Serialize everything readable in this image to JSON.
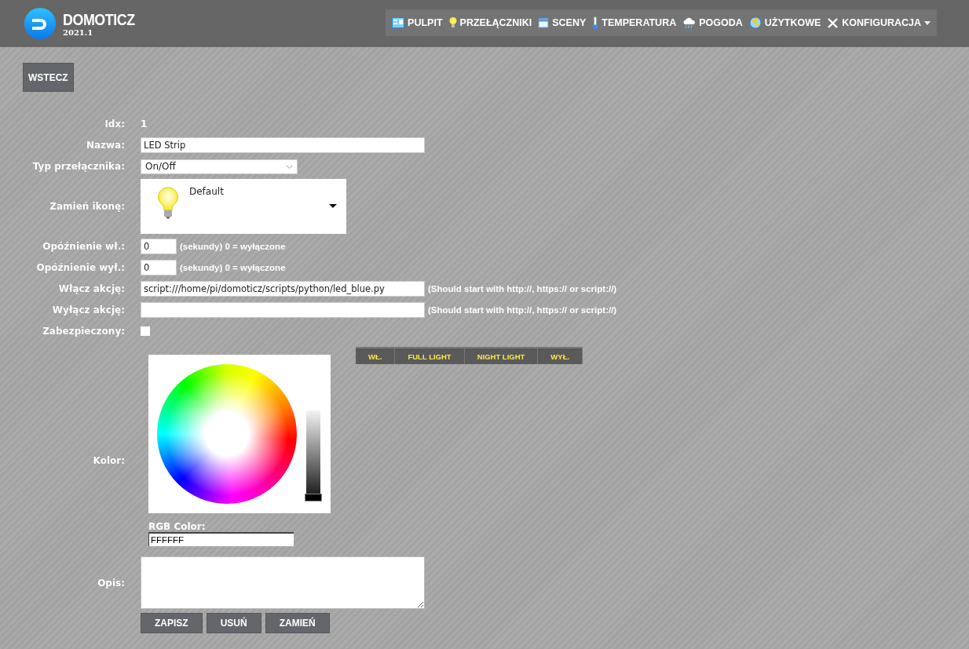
{
  "header": {
    "title": "DOMOTICZ",
    "version": "2021.1"
  },
  "nav": [
    {
      "label": "PULPIT",
      "dropdown": false
    },
    {
      "label": "PRZEŁĄCZNIKI",
      "dropdown": false
    },
    {
      "label": "SCENY",
      "dropdown": false
    },
    {
      "label": "TEMPERATURA",
      "dropdown": false
    },
    {
      "label": "POGODA",
      "dropdown": false
    },
    {
      "label": "UŻYTKOWE",
      "dropdown": false
    },
    {
      "label": "KONFIGURACJA",
      "dropdown": true
    }
  ],
  "back_button": "WSTECZ",
  "fields": [
    {
      "kind": "text",
      "label": "Idx:",
      "value": "1"
    },
    {
      "kind": "input",
      "label": "Nazwa:",
      "value": "LED Strip"
    },
    {
      "kind": "select",
      "label": "Typ przełącznika:",
      "value": "On/Off"
    },
    {
      "kind": "icon",
      "label": "Zamień ikonę:",
      "value": "Default"
    },
    {
      "kind": "delay",
      "label": "Opóźnienie wł.:",
      "value": "0",
      "hint": "(sekundy) 0 = wyłączone"
    },
    {
      "kind": "delay",
      "label": "Opóźnienie wył.:",
      "value": "0",
      "hint": "(sekundy) 0 = wyłączone"
    },
    {
      "kind": "action",
      "label": "Włącz akcję:",
      "value": "script:///home/pi/domoticz/scripts/python/led_blue.py",
      "hint": "(Should start with http://, https:// or script://)"
    },
    {
      "kind": "action",
      "label": "Wyłącz akcję:",
      "hint": "(Should start with http://, https:// or script://)"
    },
    {
      "kind": "checkbox",
      "label": "Zabezpieczony:",
      "checked": false
    }
  ],
  "color": {
    "label": "Kolor:",
    "presets": [
      "WŁ.",
      "FULL LIGHT",
      "NIGHT LIGHT",
      "WYŁ."
    ],
    "brightness": {
      "level": 0
    },
    "rgb_label": "RGB Color:",
    "rgb_value": "FFFFFF"
  },
  "description": {
    "label": "Opis:"
  },
  "buttons": [
    "ZAPISZ",
    "USUŃ",
    "ZAMIEŃ"
  ]
}
